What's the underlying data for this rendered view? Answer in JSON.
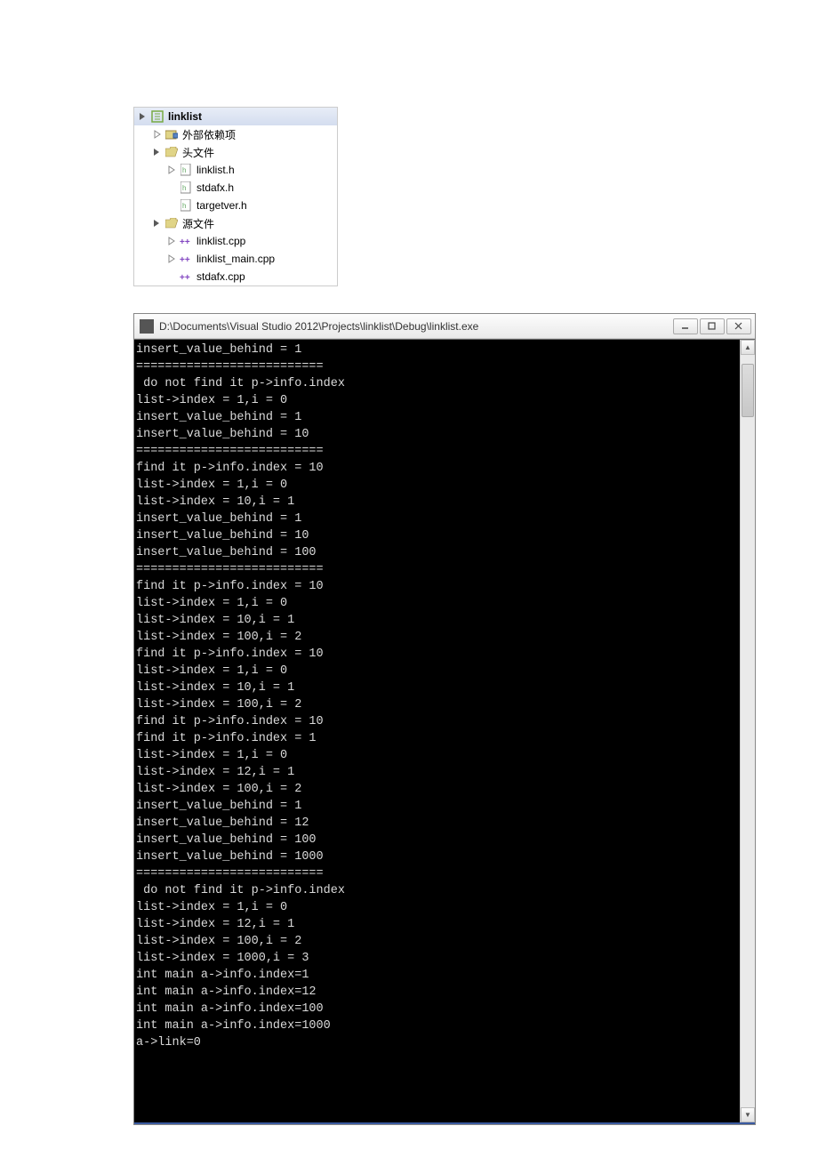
{
  "tree": {
    "root": {
      "label": "linklist"
    },
    "items": [
      {
        "label": "外部依赖项"
      },
      {
        "label": "头文件"
      },
      {
        "label": "linklist.h"
      },
      {
        "label": "stdafx.h"
      },
      {
        "label": "targetver.h"
      },
      {
        "label": "源文件"
      },
      {
        "label": "linklist.cpp"
      },
      {
        "label": "linklist_main.cpp"
      },
      {
        "label": "stdafx.cpp"
      }
    ]
  },
  "console": {
    "title": "D:\\Documents\\Visual Studio 2012\\Projects\\linklist\\Debug\\linklist.exe",
    "lines": [
      "insert_value_behind = 1",
      "==========================",
      " do not find it p->info.index",
      "list->index = 1,i = 0",
      "insert_value_behind = 1",
      "insert_value_behind = 10",
      "==========================",
      "find it p->info.index = 10",
      "list->index = 1,i = 0",
      "list->index = 10,i = 1",
      "insert_value_behind = 1",
      "insert_value_behind = 10",
      "insert_value_behind = 100",
      "==========================",
      "find it p->info.index = 10",
      "list->index = 1,i = 0",
      "list->index = 10,i = 1",
      "list->index = 100,i = 2",
      "find it p->info.index = 10",
      "list->index = 1,i = 0",
      "list->index = 10,i = 1",
      "list->index = 100,i = 2",
      "find it p->info.index = 10",
      "find it p->info.index = 1",
      "list->index = 1,i = 0",
      "list->index = 12,i = 1",
      "list->index = 100,i = 2",
      "insert_value_behind = 1",
      "insert_value_behind = 12",
      "insert_value_behind = 100",
      "insert_value_behind = 1000",
      "==========================",
      " do not find it p->info.index",
      "list->index = 1,i = 0",
      "list->index = 12,i = 1",
      "list->index = 100,i = 2",
      "list->index = 1000,i = 3",
      "int main a->info.index=1",
      "int main a->info.index=12",
      "int main a->info.index=100",
      "int main a->info.index=1000",
      "a->link=0",
      ""
    ]
  }
}
